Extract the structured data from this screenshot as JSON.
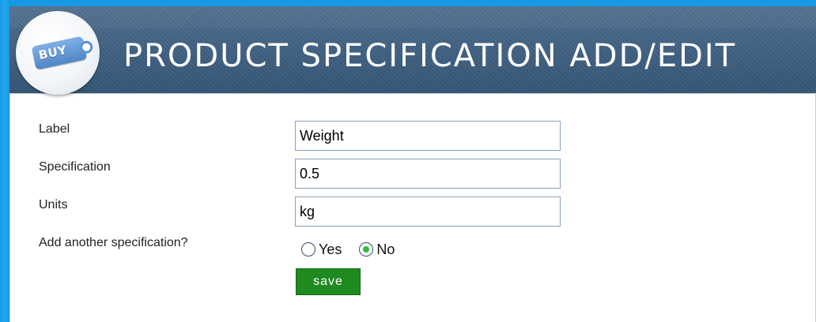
{
  "header": {
    "logo_text": "BUY",
    "title": "PRODUCT SPECIFICATION ADD/EDIT"
  },
  "form": {
    "label_field": {
      "label": "Label",
      "value": "Weight"
    },
    "specification_field": {
      "label": "Specification",
      "value": "0.5"
    },
    "units_field": {
      "label": "Units",
      "value": "kg"
    },
    "add_another": {
      "label": "Add another specification?",
      "options": [
        {
          "label": "Yes",
          "selected": false
        },
        {
          "label": "No",
          "selected": true
        }
      ]
    },
    "save_label": "save"
  },
  "colors": {
    "frame_blue": "#1aa0e6",
    "header_bg": "#3f5f80",
    "save_green": "#1f8a1f"
  }
}
